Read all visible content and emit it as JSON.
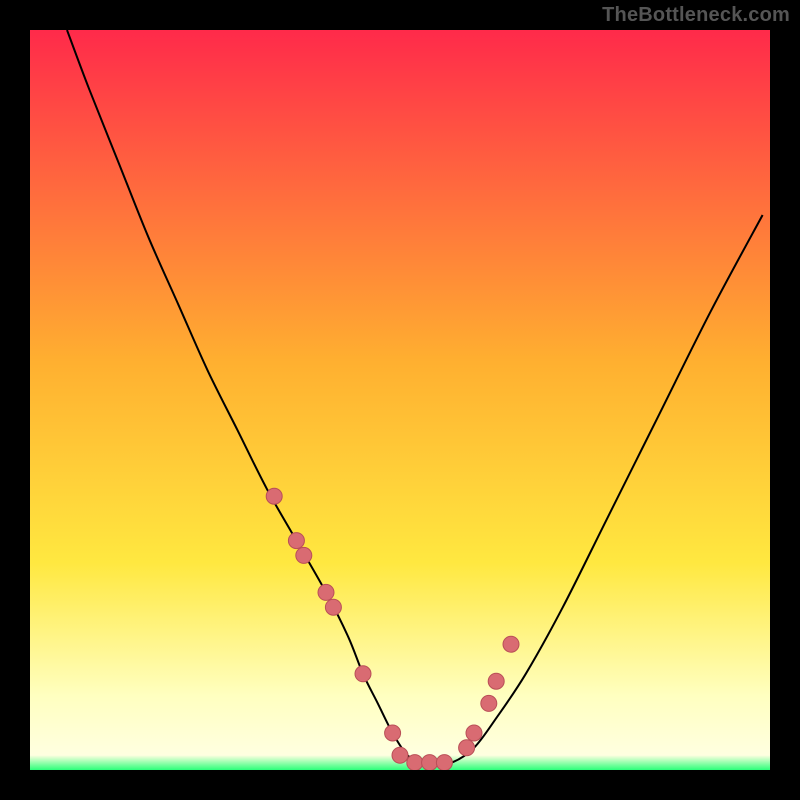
{
  "watermark": "TheBottleneck.com",
  "colors": {
    "frame_bg": "#000000",
    "gradient_top": "#ff2a4a",
    "gradient_mid1": "#ffb030",
    "gradient_mid2": "#ffe840",
    "gradient_pale": "#ffffc0",
    "gradient_bottom": "#2cff7a",
    "curve": "#000000",
    "marker_fill": "#d96b72",
    "marker_stroke": "#b94f57"
  },
  "chart_data": {
    "type": "line",
    "title": "",
    "xlabel": "",
    "ylabel": "",
    "xlim": [
      0,
      100
    ],
    "ylim": [
      0,
      100
    ],
    "series": [
      {
        "name": "bottleneck-curve",
        "x": [
          5,
          8,
          12,
          16,
          20,
          24,
          28,
          32,
          36,
          40,
          43,
          45,
          47,
          49,
          51,
          53,
          55,
          57,
          60,
          63,
          67,
          72,
          78,
          85,
          92,
          99
        ],
        "y": [
          100,
          92,
          82,
          72,
          63,
          54,
          46,
          38,
          31,
          24,
          18,
          13,
          9,
          5,
          2,
          1,
          1,
          1,
          3,
          7,
          13,
          22,
          34,
          48,
          62,
          75
        ]
      }
    ],
    "markers": {
      "name": "highlighted-points",
      "x": [
        33,
        36,
        37,
        40,
        41,
        45,
        49,
        50,
        52,
        54,
        56,
        59,
        60,
        62,
        63,
        65
      ],
      "y": [
        37,
        31,
        29,
        24,
        22,
        13,
        5,
        2,
        1,
        1,
        1,
        3,
        5,
        9,
        12,
        17
      ]
    },
    "gradient_bands": [
      {
        "y_from": 98,
        "y_to": 100,
        "color": "#2cff7a"
      },
      {
        "y_from": 90,
        "y_to": 98,
        "color": "#ffffc0"
      },
      {
        "y_from": 60,
        "y_to": 90,
        "color": "#ffe840"
      },
      {
        "y_from": 25,
        "y_to": 60,
        "color": "#ffb030"
      },
      {
        "y_from": 0,
        "y_to": 25,
        "color": "#ff2a4a"
      }
    ]
  }
}
